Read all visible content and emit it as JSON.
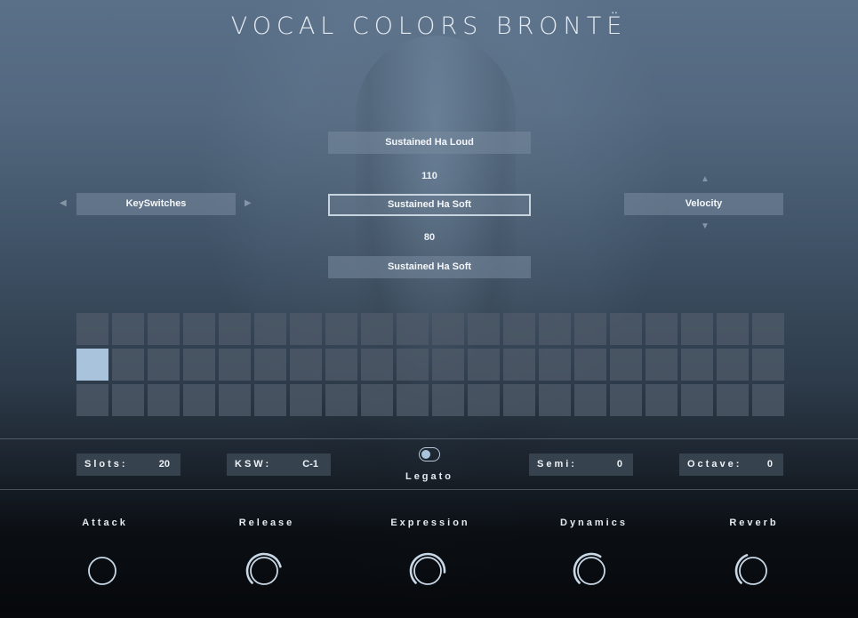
{
  "app": {
    "title": "VOCAL COLORS BRONTË"
  },
  "articulation": {
    "upper_slot": "Sustained Ha Loud",
    "upper_value": "110",
    "current_slot": "Sustained Ha Soft",
    "lower_value": "80",
    "lower_slot": "Sustained Ha Soft"
  },
  "mode_selector": {
    "label": "KeySwitches"
  },
  "trigger_selector": {
    "label": "Velocity"
  },
  "slot_grid": {
    "rows": 3,
    "columns": 20,
    "active_row": 2,
    "active_column": 1
  },
  "settings": {
    "slots": {
      "label": "Slots:",
      "value": "20"
    },
    "ksw": {
      "label": "KSW:",
      "value": "C-1"
    },
    "legato": {
      "label": "Legato",
      "on": true
    },
    "semi": {
      "label": "Semi:",
      "value": "0"
    },
    "octave": {
      "label": "Octave:",
      "value": "0"
    }
  },
  "knobs": [
    {
      "label": "Attack",
      "level": 0.0
    },
    {
      "label": "Release",
      "level": 0.78
    },
    {
      "label": "Expression",
      "level": 0.85
    },
    {
      "label": "Dynamics",
      "level": 0.62
    },
    {
      "label": "Reverb",
      "level": 0.42
    }
  ],
  "colors": {
    "accent": "#a9c3dc",
    "knob_ring": "#c9d8e6",
    "knob_track": "#4a5866"
  }
}
